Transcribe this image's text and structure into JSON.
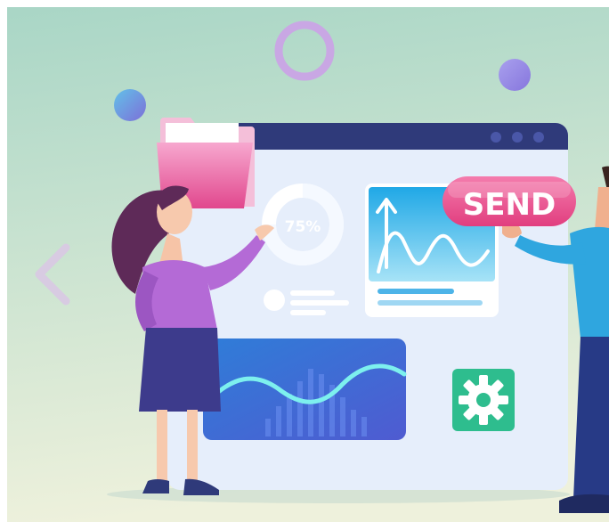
{
  "illustration": {
    "donut_label": "75%",
    "donut_fraction": 0.75,
    "send_label": "SEND",
    "colors": {
      "background_top": "#a9d6c6",
      "background_bottom": "#eef1dc",
      "window_frame": "#2f3a7a",
      "window_panel": "#e6eefb",
      "send_pink": "#e94c8e",
      "gear_green": "#2ebd8e"
    },
    "icons": [
      "folder-icon",
      "gear-icon",
      "chevron-left-icon",
      "arrow-up-icon"
    ]
  }
}
